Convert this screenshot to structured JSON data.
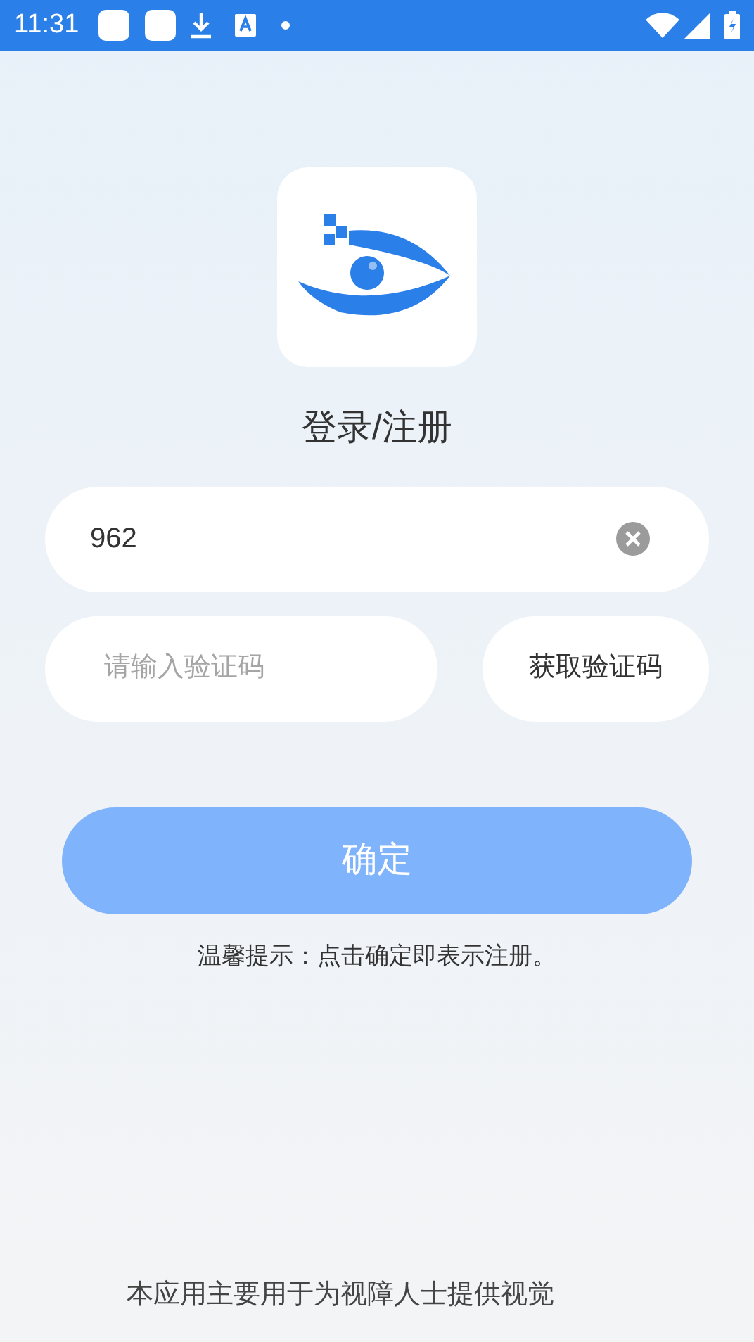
{
  "status_bar": {
    "time": "11:31"
  },
  "title": "登录/注册",
  "phone_field": {
    "value": "962"
  },
  "code_field": {
    "placeholder": "请输入验证码"
  },
  "get_code_button": "获取验证码",
  "confirm_button": {
    "label": "确定",
    "disabled": true
  },
  "hint": "温馨提示：点击确定即表示注册。",
  "footer": "本应用主要用于为视障人士提供视觉"
}
